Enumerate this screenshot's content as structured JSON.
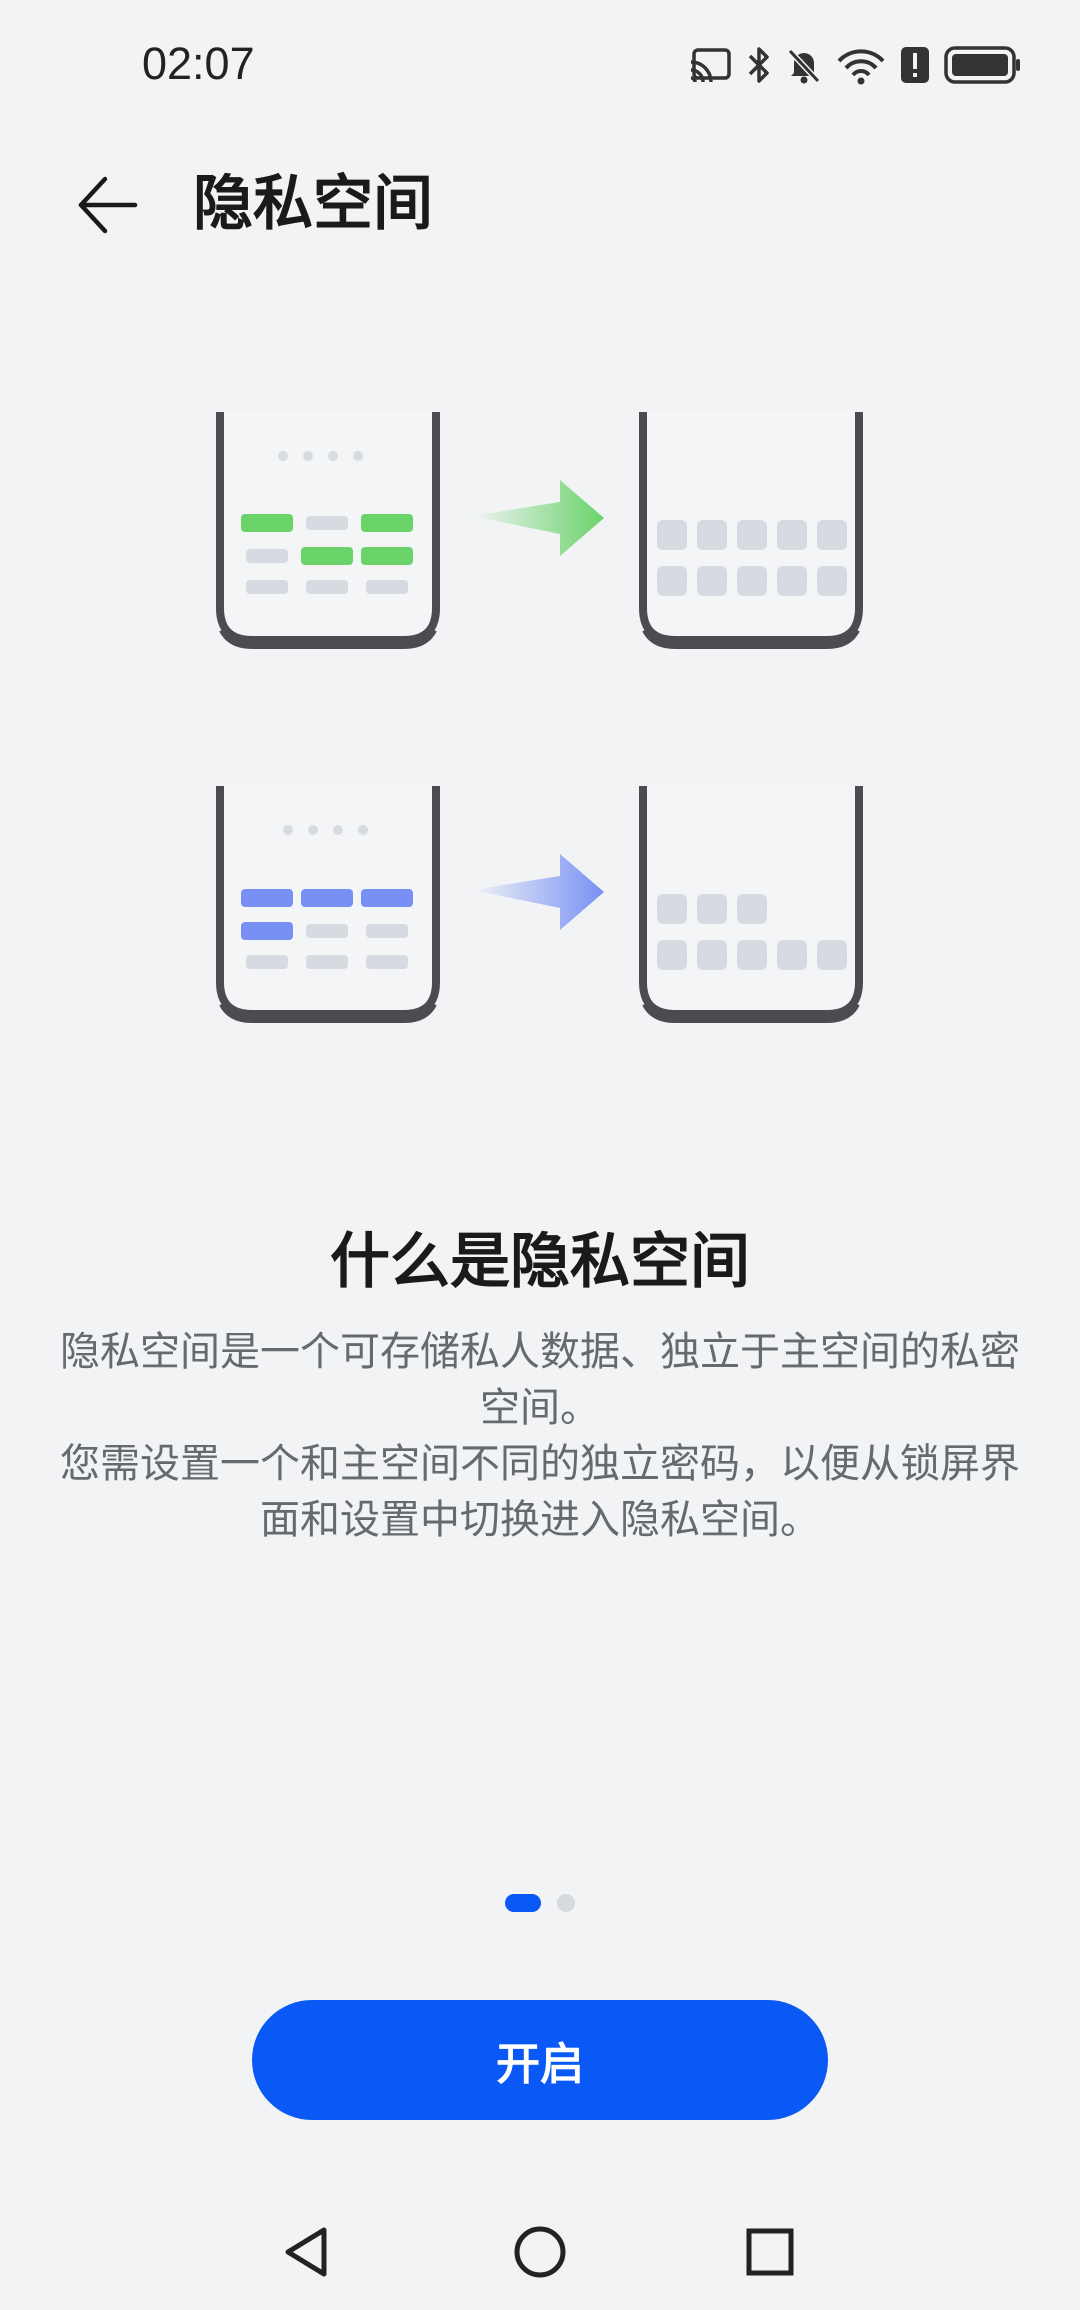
{
  "status_bar": {
    "time": "02:07",
    "icons": [
      "cast-icon",
      "bluetooth-icon",
      "mute-bell-icon",
      "wifi-icon",
      "alert-icon",
      "battery-icon"
    ]
  },
  "header": {
    "back_icon": "arrow-left-icon",
    "title": "隐私空间"
  },
  "intro": {
    "title": "什么是隐私空间",
    "paragraphs": [
      "隐私空间是一个可存储私人数据、独立于主空间的私密空间。",
      "您需设置一个和主空间不同的独立密码，以便从锁屏界面和设置中切换进入隐私空间。"
    ]
  },
  "pager": {
    "current": 1,
    "total": 2
  },
  "primary_button": {
    "label": "开启"
  },
  "nav_bar": {
    "icons": [
      "back-triangle-icon",
      "home-circle-icon",
      "recents-square-icon"
    ]
  },
  "colors": {
    "accent": "#0a59f7",
    "green": "#6ad36a",
    "blue": "#7890f4",
    "phone_frame": "#4a4c52",
    "tile": "#d7dae0"
  }
}
